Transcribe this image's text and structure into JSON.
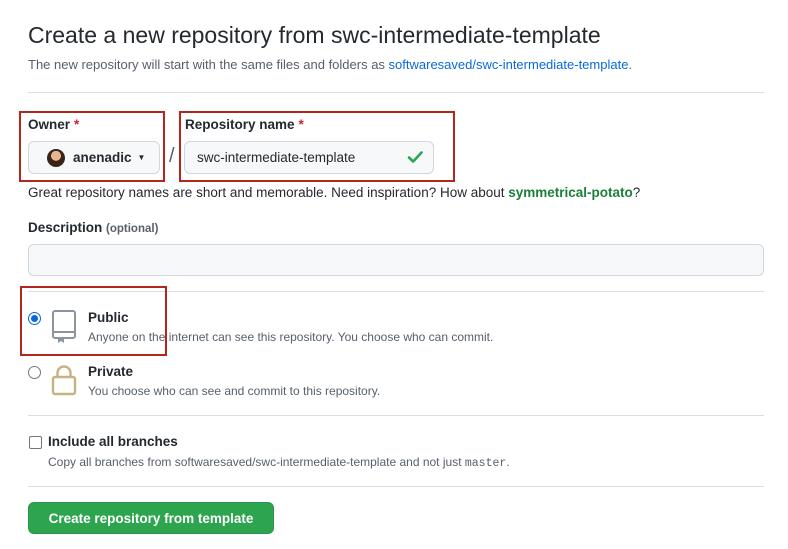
{
  "header": {
    "title": "Create a new repository from swc-intermediate-template",
    "subtitle_prefix": "The new repository will start with the same files and folders as ",
    "template_link": "softwaresaved/swc-intermediate-template",
    "subtitle_suffix": "."
  },
  "owner": {
    "label": "Owner",
    "required_mark": "*",
    "value": "anenadic"
  },
  "separator": "/",
  "repo_name": {
    "label": "Repository name",
    "required_mark": "*",
    "value": "swc-intermediate-template"
  },
  "hint": {
    "prefix": "Great repository names are short and memorable. Need inspiration? How about ",
    "suggestion": "symmetrical-potato",
    "suffix": "?"
  },
  "description": {
    "label": "Description",
    "optional": "(optional)",
    "value": ""
  },
  "visibility": {
    "public": {
      "title": "Public",
      "desc": "Anyone on the internet can see this repository. You choose who can commit.",
      "checked": true
    },
    "private": {
      "title": "Private",
      "desc": "You choose who can see and commit to this repository.",
      "checked": false
    }
  },
  "branches": {
    "title": "Include all branches",
    "desc_prefix": "Copy all branches from softwaresaved/swc-intermediate-template and not just ",
    "branch": "master",
    "desc_suffix": ".",
    "checked": false
  },
  "submit": {
    "label": "Create repository from template"
  },
  "colors": {
    "accent": "#0969da",
    "success": "#2da44e",
    "annotation": "#b3261e",
    "required": "#cf222e"
  }
}
